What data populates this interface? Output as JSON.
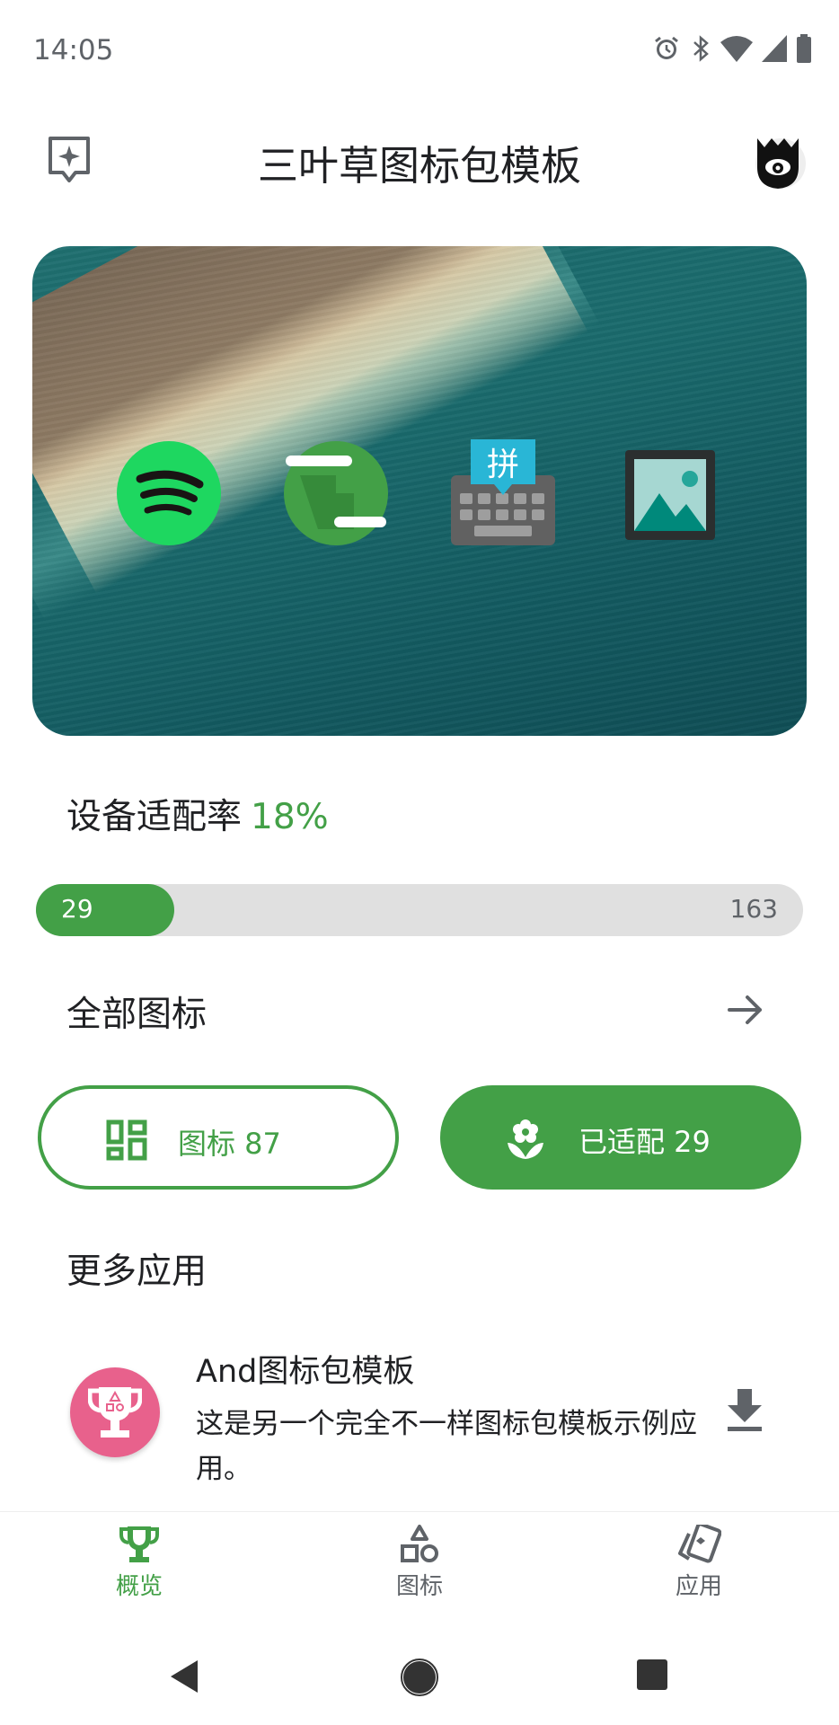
{
  "status_bar": {
    "time": "14:05",
    "icons": [
      "alarm-icon",
      "bluetooth-icon",
      "wifi-icon",
      "signal-icon",
      "battery-icon"
    ]
  },
  "app_bar": {
    "title": "三叶草图标包模板",
    "left_icon": "sparkle-badge-icon",
    "right_icon": "mask-avatar-icon"
  },
  "hero": {
    "icons": [
      "spotify-icon",
      "terminal-app-icon",
      "pinyin-keyboard-icon",
      "gallery-icon"
    ],
    "pinyin_glyph": "拼"
  },
  "adaptation": {
    "label": "设备适配率",
    "rate": "18%",
    "rate_fraction": 0.18,
    "adapted_count": "29",
    "total_count": "163"
  },
  "all_icons": {
    "label": "全部图标"
  },
  "buttons": {
    "icons_label": "图标 87",
    "adapted_label": "已适配 29"
  },
  "more_apps": {
    "title": "更多应用",
    "items": [
      {
        "name": "And图标包模板",
        "description": "这是另一个完全不一样图标包模板示例应用。"
      }
    ]
  },
  "bottom_nav": {
    "items": [
      {
        "label": "概览",
        "icon": "trophy-icon",
        "active": true
      },
      {
        "label": "图标",
        "icon": "shapes-icon",
        "active": false
      },
      {
        "label": "应用",
        "icon": "cards-icon",
        "active": false
      }
    ]
  },
  "colors": {
    "accent": "#43a047",
    "progress_track": "#e0e0e0",
    "avatar_pink": "#e8618c"
  }
}
